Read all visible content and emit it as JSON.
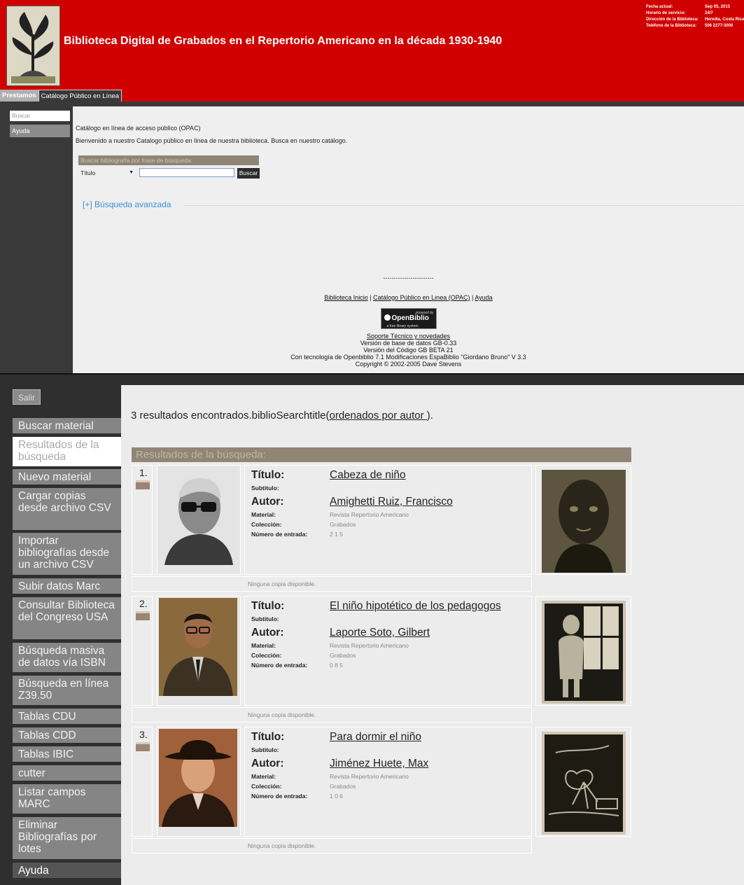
{
  "top": {
    "title": "Biblioteca Digital de Grabados en el Repertorio Americano en la década 1930-1940",
    "info": [
      {
        "label": "Fecha actual:",
        "value": "Sep 05, 2015"
      },
      {
        "label": "Horario de servicio:",
        "value": "24/7"
      },
      {
        "label": "Dirección de la Biblioteca:",
        "value": "Heredia, Costa Rica"
      },
      {
        "label": "Teléfono de la Biblioteca:",
        "value": "506 2277-3000"
      }
    ],
    "tabs": {
      "loans": "Prestamos",
      "opac": "Catálogo Público en Línea"
    },
    "sidebar": {
      "search_placeholder": "Buscar",
      "help": "Ayuda"
    },
    "opac_title": "Catálogo en línea de acceso público (OPAC)",
    "welcome": "Bienvenido a nuestro Catalogo público en línea de nuestra biblioteca. Busca en nuestro catálogo.",
    "search_box": {
      "title": "Buscar bibliografía por frase de búsqueda:",
      "field": "Título",
      "button": "Buscar",
      "input_value": ""
    },
    "advanced": "[+] Búsqueda avanzada",
    "footer": {
      "dashes": "------------------------",
      "link_home": "Biblioteca Inicio",
      "link_opac": "Catálogo Público en Linea (OPAC)",
      "link_help": "Ayuda",
      "badge_powered": "powered by",
      "badge_name": "OpenBiblio",
      "badge_sub": "a free library system",
      "support": "Soporte Técnico y novedades",
      "db_version": "Versión de base de datos GB-0.33",
      "code_version": "Versión del Código GB BETA 21",
      "tech": "Con tecnología de Openbiblio 7.1 Modificaciones EspaBiblio \"Giordano Bruno\" V 3.3",
      "copyright": "Copyright © 2002-2005 Dave Stevens"
    }
  },
  "bottom": {
    "logout": "Salir",
    "nav": [
      "Buscar material",
      "Resultados de la búsqueda",
      "Nuevo material",
      "Cargar copias desde archivo CSV",
      "Importar bibliografías desde un archivo CSV",
      "Subir datos Marc",
      "Consultar Biblioteca del Congreso USA",
      "Búsqueda masiva de datos vía ISBN",
      "Búsqueda en línea Z39.50",
      "Tablas CDU",
      "Tablas CDD",
      "Tablas IBIC",
      "cutter",
      "Listar campos MARC",
      "Eliminar Bibliografías por lotes",
      "Ayuda"
    ],
    "summary_prefix": "3 resultados encontrados.biblioSearchtitle(",
    "summary_link": "ordenados por autor ",
    "summary_suffix": ").",
    "results_header": "Resultados de la búsqueda:",
    "labels": {
      "title": "Título:",
      "subtitle": "Subtitulo:",
      "author": "Autor:",
      "material": "Material:",
      "collection": "Colección:",
      "entry": "Número de entrada:"
    },
    "results": [
      {
        "num": "1.",
        "title": "Cabeza de niño",
        "author": "Amighetti Ruiz, Francisco",
        "material": "Revista Repertorio Americano",
        "collection": "Grabados",
        "entry": "2 1 5",
        "copies": "Ninguna copia disponible."
      },
      {
        "num": "2.",
        "title": "El niño hipotético de los pedagogos",
        "author": "Laporte Soto, Gilbert",
        "material": "Revista Repertorio Americano",
        "collection": "Grabados",
        "entry": "0 8 5",
        "copies": "Ninguna copia disponible."
      },
      {
        "num": "3.",
        "title": "Para dormir el niño",
        "author": "Jiménez Huete, Max",
        "material": "Revista Repertorio Americano",
        "collection": "Grabados",
        "entry": "1 0 6",
        "copies": "Ninguna copia disponible."
      }
    ]
  }
}
